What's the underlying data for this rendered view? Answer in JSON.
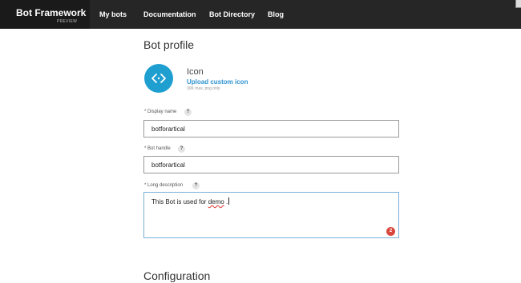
{
  "topbar": {
    "brand_name": "Bot Framework",
    "brand_sub": "PREVIEW",
    "nav": [
      "My bots",
      "Documentation",
      "Bot Directory",
      "Blog"
    ]
  },
  "profile": {
    "title": "Bot profile",
    "icon_label": "Icon",
    "upload_link": "Upload custom icon",
    "upload_hint": "30K max, png only",
    "icon": "bot-code-icon"
  },
  "fields": {
    "display_name": {
      "label": "* Display name",
      "value": "botforartical",
      "help": "?"
    },
    "bot_handle": {
      "label": "* Bot handle",
      "value": "botforartical",
      "help": "?"
    },
    "long_description": {
      "label": "* Long description",
      "text_before": "This Bot is used for ",
      "text_misspelled": "demo",
      "text_after": " .",
      "help": "?",
      "error_count": "2"
    }
  },
  "configuration": {
    "title": "Configuration"
  },
  "colors": {
    "accent": "#1f9fd0",
    "link": "#2f93d1",
    "error": "#d9473d",
    "topbar": "#262626"
  }
}
